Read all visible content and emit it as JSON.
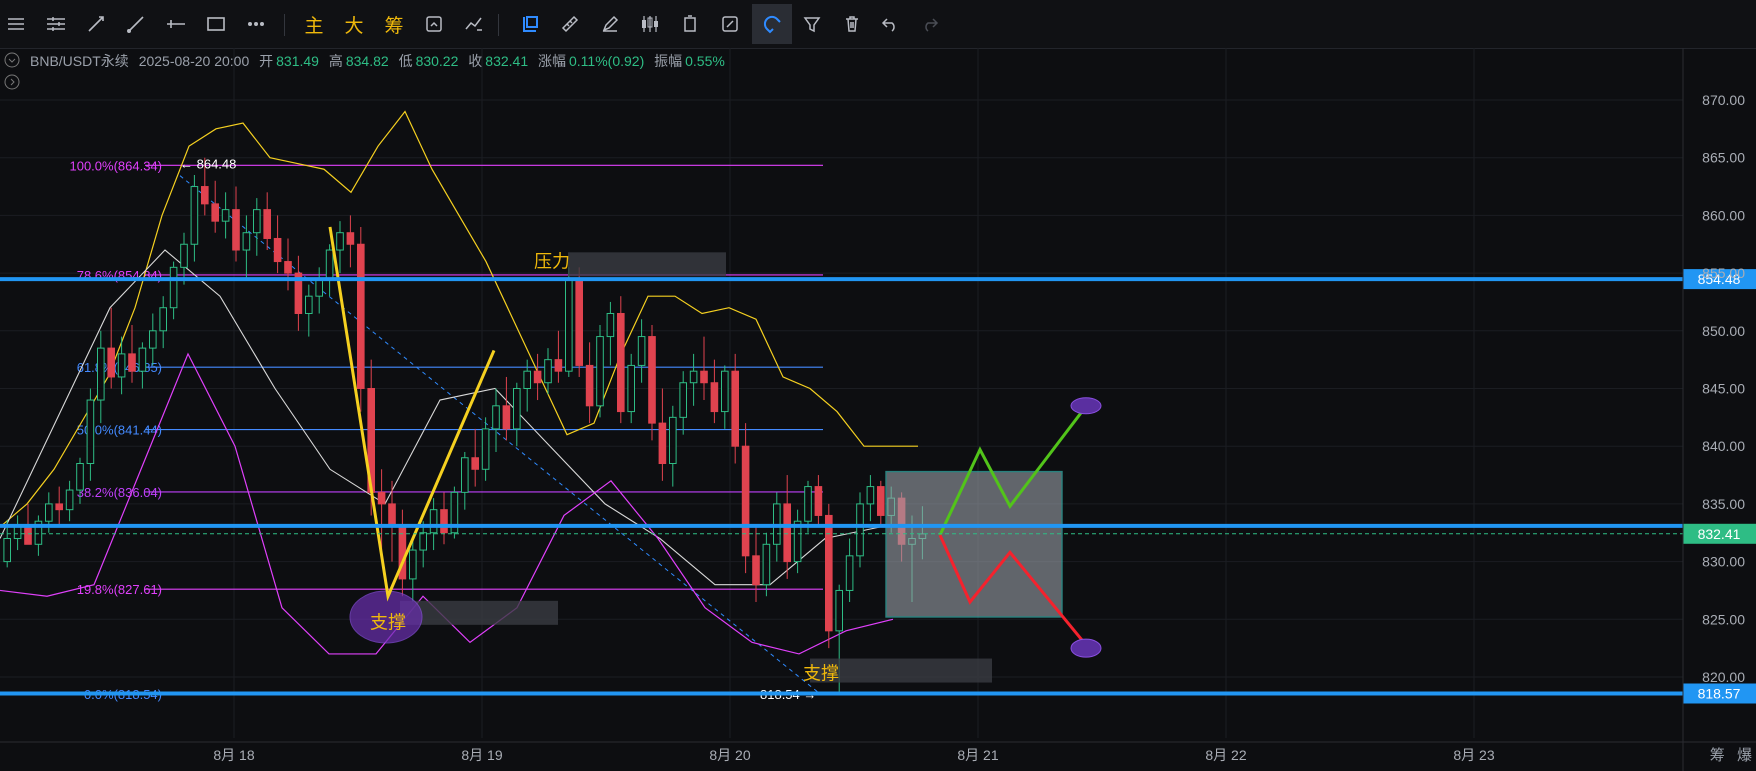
{
  "toolbar": {
    "tools": [
      "menu-icon",
      "horizontal-lines-icon",
      "trend-line-icon",
      "ray-icon",
      "horizontal-ray-icon",
      "rectangle-icon",
      "more-icon"
    ],
    "text_tools": [
      "主",
      "大",
      "筹"
    ],
    "tools2": [
      "refresh-indicator-icon",
      "swap-indicator-icon",
      "drawing-mode-icon",
      "ruler-icon",
      "pen-icon",
      "candle-style-icon",
      "layout-icon",
      "edit-icon",
      "magnet-icon",
      "filter-icon",
      "trash-icon",
      "undo-icon",
      "redo-icon"
    ]
  },
  "info": {
    "symbol": "BNB/USDT永续",
    "datetime": "2025-08-20 20:00",
    "open_label": "开",
    "open": "831.49",
    "high_label": "高",
    "high": "834.82",
    "low_label": "低",
    "low": "830.22",
    "close_label": "收",
    "close": "832.41",
    "change_label": "涨幅",
    "change": "0.11%(0.92)",
    "amp_label": "振幅",
    "amp": "0.55%"
  },
  "bottom_right": [
    "筹",
    "爆"
  ],
  "chart_data": {
    "type": "candlestick",
    "y_ticks": [
      820,
      825,
      830,
      835,
      840,
      845,
      850,
      855,
      860,
      865,
      870
    ],
    "ylim": [
      814,
      875
    ],
    "x_ticks": [
      "8月 18",
      "8月 19",
      "8月 20",
      "8月 21",
      "8月 22",
      "8月 23"
    ],
    "price_tags": [
      {
        "value": 854.48,
        "label": "854.48",
        "color": "#2196f3"
      },
      {
        "value": 832.41,
        "label": "832.41",
        "color": "#2ebd85"
      },
      {
        "value": 818.57,
        "label": "818.57",
        "color": "#2196f3"
      }
    ],
    "fib_levels": [
      {
        "label": "100.0%(864.34)",
        "value": 864.34,
        "color": "#e040fb"
      },
      {
        "label": "78.6%(854.84)",
        "value": 854.84,
        "color": "#e040fb"
      },
      {
        "label": "61.8%(846.85)",
        "value": 846.85,
        "color": "#448aff"
      },
      {
        "label": "50.0%(841.44)",
        "value": 841.44,
        "color": "#448aff"
      },
      {
        "label": "38.2%(836.04)",
        "value": 836.04,
        "color": "#c040fb"
      },
      {
        "label": "19.8%(827.61)",
        "value": 827.61,
        "color": "#e040fb"
      },
      {
        "label": "0.0%(818.54)",
        "value": 818.54,
        "color": "#448aff"
      }
    ],
    "annotations": [
      {
        "text": "压力"
      },
      {
        "text": "支撑"
      },
      {
        "text": "支撑"
      },
      {
        "text": "864.48"
      },
      {
        "text": "818.54"
      }
    ],
    "candles": [
      [
        830.0,
        833.6,
        829.5,
        832.0
      ],
      [
        832.0,
        834.0,
        831.0,
        833.0
      ],
      [
        833.0,
        835.0,
        832.0,
        831.5
      ],
      [
        831.5,
        834.0,
        830.5,
        833.5
      ],
      [
        833.5,
        836.0,
        832.5,
        835.0
      ],
      [
        835.0,
        836.5,
        833.0,
        834.5
      ],
      [
        834.5,
        837.0,
        833.5,
        836.2
      ],
      [
        836.2,
        839.0,
        835.0,
        838.5
      ],
      [
        838.5,
        845.0,
        837.0,
        844.0
      ],
      [
        844.0,
        850.0,
        842.0,
        848.5
      ],
      [
        848.5,
        852.0,
        845.0,
        846.0
      ],
      [
        846.0,
        849.5,
        844.5,
        848.0
      ],
      [
        848.0,
        850.5,
        845.5,
        846.5
      ],
      [
        846.5,
        849.0,
        845.0,
        848.5
      ],
      [
        848.5,
        851.5,
        847.0,
        850.0
      ],
      [
        850.0,
        853.0,
        848.5,
        852.0
      ],
      [
        852.0,
        856.0,
        851.0,
        855.5
      ],
      [
        855.5,
        858.5,
        854.0,
        857.5
      ],
      [
        857.5,
        863.5,
        856.0,
        862.5
      ],
      [
        862.5,
        865.0,
        860.0,
        861.0
      ],
      [
        861.0,
        863.0,
        858.5,
        859.5
      ],
      [
        859.5,
        862.0,
        858.0,
        860.5
      ],
      [
        860.5,
        862.5,
        856.0,
        857.0
      ],
      [
        857.0,
        860.0,
        854.5,
        858.5
      ],
      [
        858.5,
        861.5,
        856.5,
        860.5
      ],
      [
        860.5,
        862.0,
        857.0,
        858.0
      ],
      [
        858.0,
        860.0,
        855.0,
        856.0
      ],
      [
        856.0,
        858.0,
        853.5,
        855.0
      ],
      [
        855.0,
        856.5,
        850.0,
        851.5
      ],
      [
        851.5,
        854.0,
        849.5,
        853.0
      ],
      [
        853.0,
        855.5,
        851.5,
        854.5
      ],
      [
        854.5,
        857.5,
        853.0,
        857.0
      ],
      [
        857.0,
        859.5,
        855.0,
        858.5
      ],
      [
        858.5,
        860.0,
        855.5,
        857.5
      ],
      [
        857.5,
        859.0,
        843.0,
        845.0
      ],
      [
        845.0,
        847.5,
        834.0,
        836.0
      ],
      [
        836.0,
        838.0,
        831.0,
        835.0
      ],
      [
        835.0,
        837.0,
        830.0,
        833.0
      ],
      [
        833.0,
        834.5,
        827.0,
        828.5
      ],
      [
        828.5,
        832.0,
        826.5,
        831.0
      ],
      [
        831.0,
        833.5,
        829.5,
        832.5
      ],
      [
        832.5,
        835.5,
        831.0,
        834.5
      ],
      [
        834.5,
        836.0,
        831.5,
        832.5
      ],
      [
        832.5,
        836.5,
        832.0,
        836.0
      ],
      [
        836.0,
        839.5,
        834.5,
        839.0
      ],
      [
        839.0,
        841.5,
        836.5,
        838.0
      ],
      [
        838.0,
        842.5,
        837.0,
        841.5
      ],
      [
        841.5,
        845.0,
        839.5,
        843.5
      ],
      [
        843.5,
        846.0,
        840.5,
        841.5
      ],
      [
        841.5,
        845.5,
        840.0,
        845.0
      ],
      [
        845.0,
        847.5,
        843.0,
        846.5
      ],
      [
        846.5,
        848.0,
        844.0,
        845.5
      ],
      [
        845.5,
        848.5,
        844.5,
        847.5
      ],
      [
        847.5,
        850.0,
        845.5,
        846.5
      ],
      [
        846.5,
        855.5,
        846.0,
        854.5
      ],
      [
        854.5,
        855.5,
        846.0,
        847.0
      ],
      [
        847.0,
        849.0,
        842.0,
        843.5
      ],
      [
        843.5,
        850.5,
        842.5,
        849.5
      ],
      [
        849.5,
        852.5,
        847.0,
        851.5
      ],
      [
        851.5,
        853.0,
        842.0,
        843.0
      ],
      [
        843.0,
        848.0,
        842.0,
        847.0
      ],
      [
        847.0,
        851.0,
        845.5,
        849.5
      ],
      [
        849.5,
        850.5,
        840.5,
        842.0
      ],
      [
        842.0,
        845.0,
        837.0,
        838.5
      ],
      [
        838.5,
        843.5,
        836.5,
        842.5
      ],
      [
        842.5,
        846.5,
        841.0,
        845.5
      ],
      [
        845.5,
        848.0,
        843.5,
        846.5
      ],
      [
        846.5,
        849.5,
        844.0,
        845.5
      ],
      [
        845.5,
        847.5,
        842.0,
        843.0
      ],
      [
        843.0,
        847.0,
        841.5,
        846.5
      ],
      [
        846.5,
        848.0,
        838.5,
        840.0
      ],
      [
        840.0,
        842.0,
        829.0,
        830.5
      ],
      [
        830.5,
        833.0,
        826.5,
        828.0
      ],
      [
        828.0,
        832.5,
        827.0,
        831.5
      ],
      [
        831.5,
        836.0,
        830.0,
        835.0
      ],
      [
        835.0,
        837.5,
        828.5,
        830.0
      ],
      [
        830.0,
        834.5,
        829.0,
        833.5
      ],
      [
        833.5,
        837.0,
        832.5,
        836.5
      ],
      [
        836.5,
        837.5,
        833.0,
        834.0
      ],
      [
        834.0,
        835.0,
        822.5,
        824.0
      ],
      [
        824.0,
        828.0,
        818.5,
        827.5
      ],
      [
        827.5,
        832.0,
        826.5,
        830.5
      ],
      [
        830.5,
        836.0,
        829.5,
        835.0
      ],
      [
        835.0,
        837.5,
        833.5,
        836.5
      ],
      [
        836.5,
        837.0,
        833.0,
        834.0
      ],
      [
        834.0,
        836.5,
        832.5,
        835.5
      ],
      [
        835.5,
        836.0,
        830.0,
        831.5
      ],
      [
        831.5,
        834.0,
        826.5,
        832.0
      ],
      [
        832.0,
        834.8,
        830.2,
        832.4
      ]
    ],
    "yellow_band": [
      [
        829,
        833
      ],
      [
        832,
        835
      ],
      [
        836,
        838
      ],
      [
        842,
        842
      ],
      [
        848,
        846
      ],
      [
        853,
        852
      ],
      [
        858,
        860
      ],
      [
        860,
        866
      ],
      [
        864,
        867.5
      ],
      [
        868,
        868
      ],
      [
        867,
        865
      ],
      [
        865,
        864.5
      ],
      [
        864,
        864
      ],
      [
        865,
        862
      ],
      [
        867,
        866
      ],
      [
        870,
        869
      ],
      [
        868,
        864
      ],
      [
        864,
        860
      ],
      [
        860,
        856
      ],
      [
        857,
        851
      ],
      [
        853,
        846
      ],
      [
        848,
        841
      ],
      [
        844,
        842
      ],
      [
        843,
        848
      ],
      [
        851,
        853
      ],
      [
        854,
        853
      ],
      [
        852,
        851.5
      ],
      [
        851,
        852
      ],
      [
        850,
        851
      ],
      [
        849.5,
        846
      ],
      [
        848,
        845
      ],
      [
        845,
        843
      ],
      [
        842,
        840
      ],
      [
        840,
        840
      ],
      [
        840,
        840
      ]
    ],
    "gray_band": [
      [
        828,
        832
      ],
      [
        835,
        842
      ],
      [
        847,
        852
      ],
      [
        855,
        857
      ],
      [
        856,
        853
      ],
      [
        848,
        845
      ],
      [
        841,
        838
      ],
      [
        836,
        835
      ],
      [
        840,
        844
      ],
      [
        845,
        845
      ],
      [
        844,
        840
      ],
      [
        837,
        835
      ],
      [
        834,
        832
      ],
      [
        830,
        828
      ],
      [
        829,
        828
      ],
      [
        831,
        832
      ],
      [
        833,
        833
      ]
    ],
    "pink_band": [
      [
        826,
        827.5
      ],
      [
        827.5,
        827
      ],
      [
        826,
        828
      ],
      [
        832,
        838
      ],
      [
        844,
        848
      ],
      [
        847,
        840
      ],
      [
        830,
        826
      ],
      [
        823,
        822
      ],
      [
        821,
        822
      ],
      [
        824,
        827
      ],
      [
        825,
        823
      ],
      [
        824,
        826
      ],
      [
        830,
        834
      ],
      [
        836,
        837
      ],
      [
        836,
        832
      ],
      [
        828,
        826
      ],
      [
        825,
        823
      ],
      [
        822,
        822
      ],
      [
        822,
        824
      ],
      [
        825,
        825
      ]
    ],
    "x_range_days": 7.3
  }
}
